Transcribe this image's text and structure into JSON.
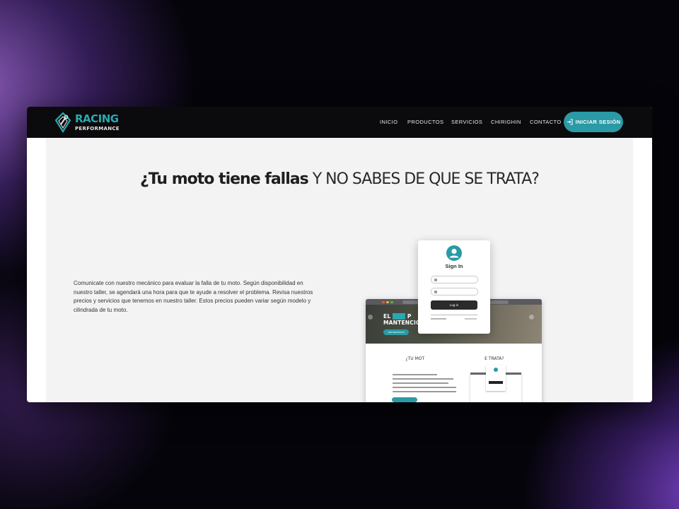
{
  "brand": {
    "name": "RACING",
    "tagline": "PERFORMANCE"
  },
  "nav": {
    "items": [
      {
        "label": "INICIO"
      },
      {
        "label": "PRODUCTOS"
      },
      {
        "label": "SERVICIOS"
      },
      {
        "label": "CHIRIGHIN"
      },
      {
        "label": "CONTACTO"
      }
    ],
    "login_label": "INICIAR SESIÓN"
  },
  "hero": {
    "headline_bold": "¿Tu moto tiene fallas",
    "headline_rest": "Y NO SABES DE QUE SE TRATA?",
    "description": "Comunicate con nuestro mecánico para evaluar la falla de tu moto. Según disponibilidad en nuestro taller, se agendará una hora para que te ayude a resolver el problema. Revisa nuestros precios y servicios que tenemos en nuestro taller. Estos precios pueden variar según modelo y cilindrada de tu moto."
  },
  "preview": {
    "hero_title_line1_a": "EL",
    "hero_title_line1_b": "P",
    "hero_title_line2": "MANTENCIÓN",
    "hero_button": "VER SERVICIOS",
    "headline_left": "¿TU MOT",
    "headline_right": "E TRATA?",
    "cta": ""
  },
  "signin_card": {
    "title": "Sign In",
    "login_button": "Log in"
  },
  "colors": {
    "accent": "#2a9aa5",
    "navbar": "#0b0b0d",
    "content_bg": "#f3f3f4"
  },
  "icons": {
    "brand": "wrench-shield-icon",
    "login": "login-arrow-icon",
    "avatar": "user-circle-icon"
  }
}
